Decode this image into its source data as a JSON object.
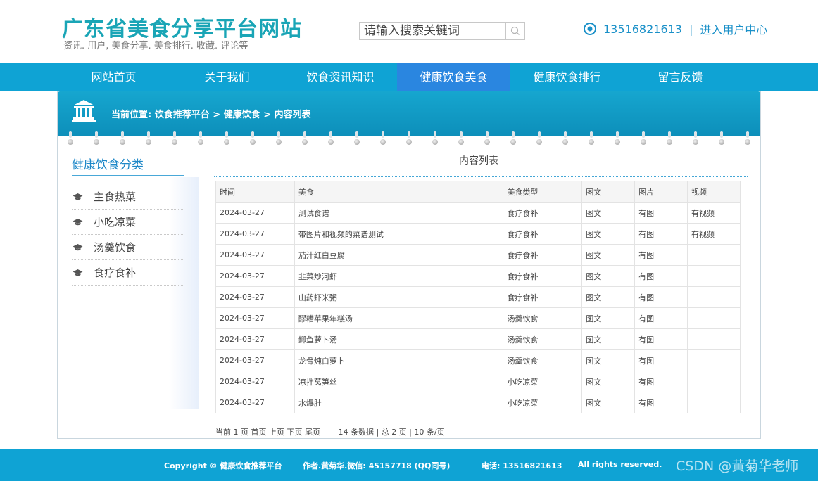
{
  "site": {
    "title": "广东省美食分享平台网站",
    "subtitle": "资讯. 用户, 美食分享. 美食排行. 收藏. 评论等"
  },
  "search": {
    "placeholder": "请输入搜索关键词"
  },
  "contact": {
    "phone": "13516821613",
    "separator": "|",
    "user_center": "进入用户中心"
  },
  "nav": [
    {
      "label": "网站首页"
    },
    {
      "label": "关于我们"
    },
    {
      "label": "饮食资讯知识"
    },
    {
      "label": "健康饮食美食"
    },
    {
      "label": "健康饮食排行"
    },
    {
      "label": "留言反馈"
    }
  ],
  "nav_active_index": 3,
  "breadcrumb": {
    "text": "当前位置: 饮食推荐平台 > 健康饮食 > 内容列表"
  },
  "sidebar": {
    "title": "健康饮食分类",
    "items": [
      {
        "label": "主食热菜"
      },
      {
        "label": "小吃凉菜"
      },
      {
        "label": "汤羹饮食"
      },
      {
        "label": "食疗食补"
      }
    ]
  },
  "content": {
    "title": "内容列表",
    "columns": [
      "时间",
      "美食",
      "美食类型",
      "图文",
      "图片",
      "视频"
    ],
    "rows": [
      [
        "2024-03-27",
        "测试食谱",
        "食疗食补",
        "图文",
        "有图",
        "有视频"
      ],
      [
        "2024-03-27",
        "带图片和视频的菜谱测试",
        "食疗食补",
        "图文",
        "有图",
        "有视频"
      ],
      [
        "2024-03-27",
        "茄汁红白豆腐",
        "食疗食补",
        "图文",
        "有图",
        ""
      ],
      [
        "2024-03-27",
        "韭菜炒河虾",
        "食疗食补",
        "图文",
        "有图",
        ""
      ],
      [
        "2024-03-27",
        "山药虾米粥",
        "食疗食补",
        "图文",
        "有图",
        ""
      ],
      [
        "2024-03-27",
        "醪糟苹果年糕汤",
        "汤羹饮食",
        "图文",
        "有图",
        ""
      ],
      [
        "2024-03-27",
        "鲫鱼萝卜汤",
        "汤羹饮食",
        "图文",
        "有图",
        ""
      ],
      [
        "2024-03-27",
        "龙骨炖白萝卜",
        "汤羹饮食",
        "图文",
        "有图",
        ""
      ],
      [
        "2024-03-27",
        "凉拌莴笋丝",
        "小吃凉菜",
        "图文",
        "有图",
        ""
      ],
      [
        "2024-03-27",
        "水爆肚",
        "小吃凉菜",
        "图文",
        "有图",
        ""
      ]
    ]
  },
  "pager": {
    "current": "当前 1 页",
    "first": "首页",
    "prev": "上页",
    "next": "下页",
    "last": "尾页",
    "info": "14 条数据 | 总 2 页 | 10 条/页"
  },
  "footer": {
    "copyright": "Copyright © 健康饮食推荐平台",
    "author": "作者.黄菊华.微信: 45157718 (QQ同号)",
    "phone": "电话: 13516821613",
    "rights": "All rights reserved.",
    "watermark": "CSDN @黄菊华老师"
  },
  "colors": {
    "brand_teal": "#1aa5b6",
    "nav_bg": "#0fa3d4",
    "nav_active": "#2a86e0",
    "link_blue": "#1a90c8"
  },
  "icons": {
    "search": "magnifier-icon",
    "location": "target-circle-icon",
    "breadcrumb": "bank-building-icon",
    "sidebar_item": "graduation-cap-icon"
  }
}
